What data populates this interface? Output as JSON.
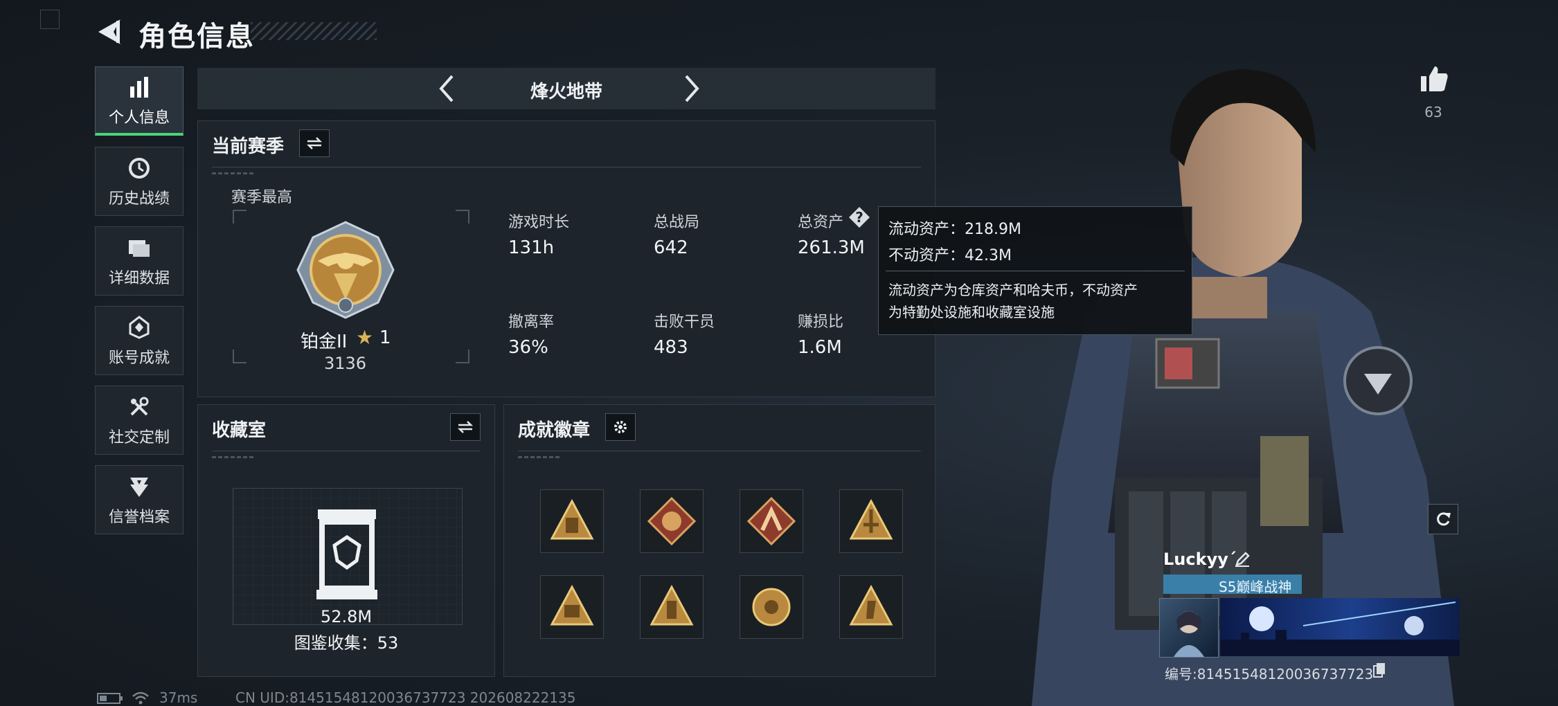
{
  "header": {
    "title": "角色信息"
  },
  "nav": [
    {
      "label": "个人信息",
      "icon": "bar-chart-icon",
      "active": true
    },
    {
      "label": "历史战绩",
      "icon": "history-icon"
    },
    {
      "label": "详细数据",
      "icon": "folder-icon"
    },
    {
      "label": "账号成就",
      "icon": "achievement-icon"
    },
    {
      "label": "社交定制",
      "icon": "tools-icon"
    },
    {
      "label": "信誉档案",
      "icon": "credit-icon"
    }
  ],
  "mode": {
    "name": "烽火地带"
  },
  "season": {
    "title": "当前赛季",
    "best_label": "赛季最高",
    "rank_name": "铂金II",
    "rank_stars": "1",
    "rank_score": "3136",
    "stats": [
      {
        "label": "游戏时长",
        "value": "131h"
      },
      {
        "label": "总战局",
        "value": "642"
      },
      {
        "label": "总资产",
        "value": "261.3M"
      },
      {
        "label": "撤离率",
        "value": "36%"
      },
      {
        "label": "击败干员",
        "value": "483"
      },
      {
        "label": "赚损比",
        "value": "1.6M"
      }
    ]
  },
  "tooltip": {
    "line1": "流动资产：218.9M",
    "line2": "不动资产：42.3M",
    "desc1": "流动资产为仓库资产和哈夫币，不动资产",
    "desc2": "为特勤处设施和收藏室设施"
  },
  "collection": {
    "title": "收藏室",
    "value": "52.8M",
    "catalog": "图鉴收集：53"
  },
  "badges": {
    "title": "成就徽章",
    "items": [
      "badge-1",
      "badge-2",
      "badge-3",
      "badge-4",
      "badge-5",
      "badge-6",
      "badge-7",
      "badge-8"
    ]
  },
  "likes": {
    "count": "63"
  },
  "profile": {
    "name": "Luckyy´",
    "title": "S5巅峰战神",
    "id": "编号:814515481200367377​23"
  },
  "footer": {
    "ping": "37ms",
    "uid": "CN UID:814515481200367377​23  202608222135"
  },
  "colors": {
    "accent": "#48d47a",
    "gold": "#c9a24a",
    "panel": "#1d242b"
  }
}
